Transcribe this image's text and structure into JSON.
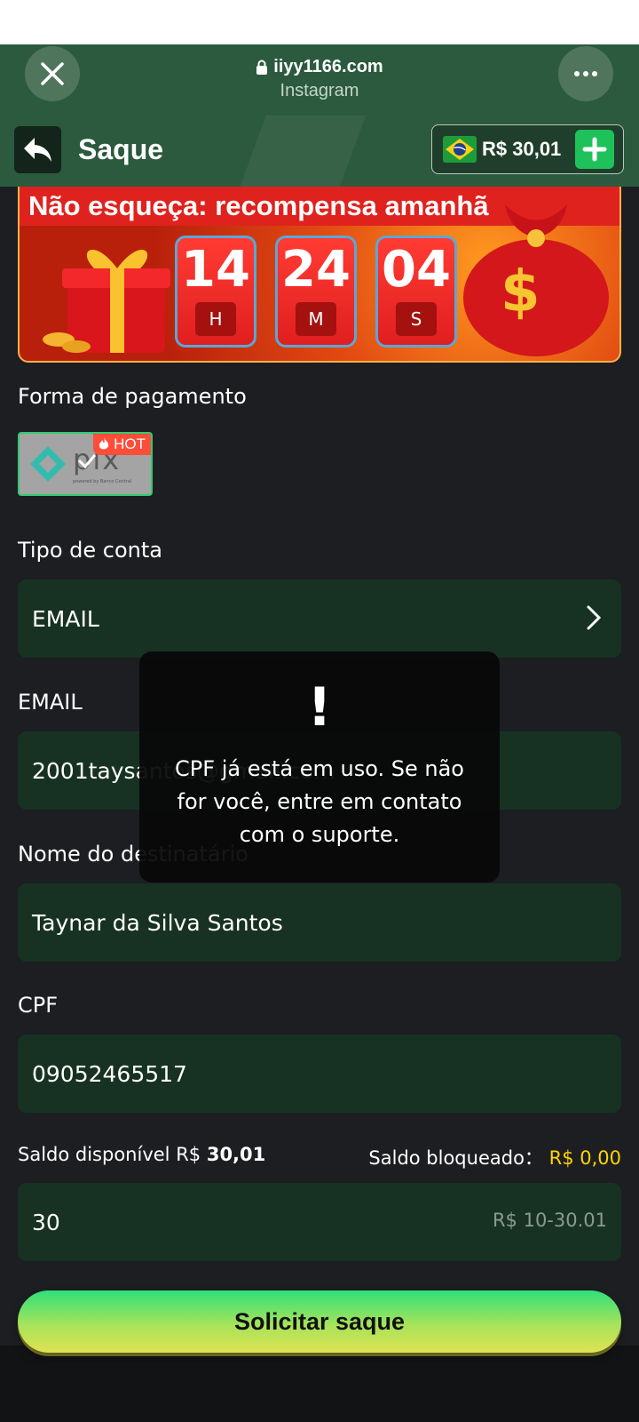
{
  "browser": {
    "domain": "iiyy1166.com",
    "subtitle": "Instagram",
    "close_icon": "close-icon",
    "more_icon": "more-icon"
  },
  "header": {
    "title": "Saque",
    "balance": "R$ 30,01",
    "back_icon": "back-arrow-icon",
    "flag_icon": "brazil-flag-icon",
    "plus_icon": "plus-icon"
  },
  "banner": {
    "title": "Não esqueça: recompensa amanhã",
    "timer": [
      {
        "value": "14",
        "unit": "H"
      },
      {
        "value": "24",
        "unit": "M"
      },
      {
        "value": "04",
        "unit": "S"
      }
    ]
  },
  "form": {
    "payment_label": "Forma de pagamento",
    "pix_text": "pix",
    "pix_sub": "powered by Banco Central",
    "hot_badge": "HOT",
    "account_type_label": "Tipo de conta",
    "account_type_value": "EMAIL",
    "email_label": "EMAIL",
    "email_value": "2001taysantos@gmail.com",
    "recipient_label": "Nome do destinatário",
    "recipient_value": "Taynar da Silva Santos",
    "cpf_label": "CPF",
    "cpf_value": "09052465517",
    "saldo_disponivel_label": "Saldo disponível",
    "saldo_disponivel_prefix": "R$",
    "saldo_disponivel_value": "30,01",
    "saldo_bloqueado_label": "Saldo bloqueado：",
    "saldo_bloqueado_value": "R$ 0,00",
    "amount_value": "30",
    "amount_range": "R$ 10-30.01",
    "submit_label": "Solicitar saque"
  },
  "toast": {
    "icon": "!",
    "message": "CPF já está em uso. Se não for você, entre em contato com o suporte."
  },
  "colors": {
    "header_green": "#2c5a3e",
    "field_bg": "#173222",
    "accent_green": "#1fc15a",
    "yellow": "#ffd400",
    "hot_red": "#ff4d3a"
  }
}
